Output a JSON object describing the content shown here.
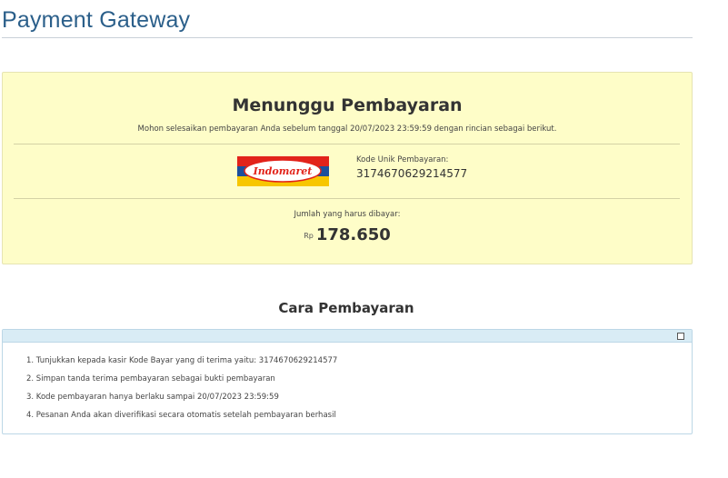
{
  "header": {
    "title": "Payment Gateway"
  },
  "waiting": {
    "title": "Menunggu Pembayaran",
    "subtitle": "Mohon selesaikan pembayaran Anda sebelum tanggal 20/07/2023 23:59:59 dengan rincian sebagai berikut.",
    "logo_text": "Indomaret",
    "code_label": "Kode Unik Pembayaran:",
    "code_value": "3174670629214577",
    "amount_label": "Jumlah yang harus dibayar:",
    "currency": "Rp",
    "amount": "178.650"
  },
  "instructions": {
    "title": "Cara Pembayaran",
    "steps": [
      "1. Tunjukkan kepada kasir Kode Bayar yang di terima yaitu: 3174670629214577",
      "2. Simpan tanda terima pembayaran sebagai bukti pembayaran",
      "3. Kode pembayaran hanya berlaku sampai 20/07/2023 23:59:59",
      "4. Pesanan Anda akan diverifikasi secara otomatis setelah pembayaran berhasil"
    ]
  },
  "colors": {
    "title_blue": "#2b5f8a",
    "box_yellow": "#fefdc8",
    "panel_header": "#d9ecf5",
    "logo_red": "#e2231a",
    "logo_blue": "#1c4f9c",
    "logo_yellow": "#f7c600"
  }
}
